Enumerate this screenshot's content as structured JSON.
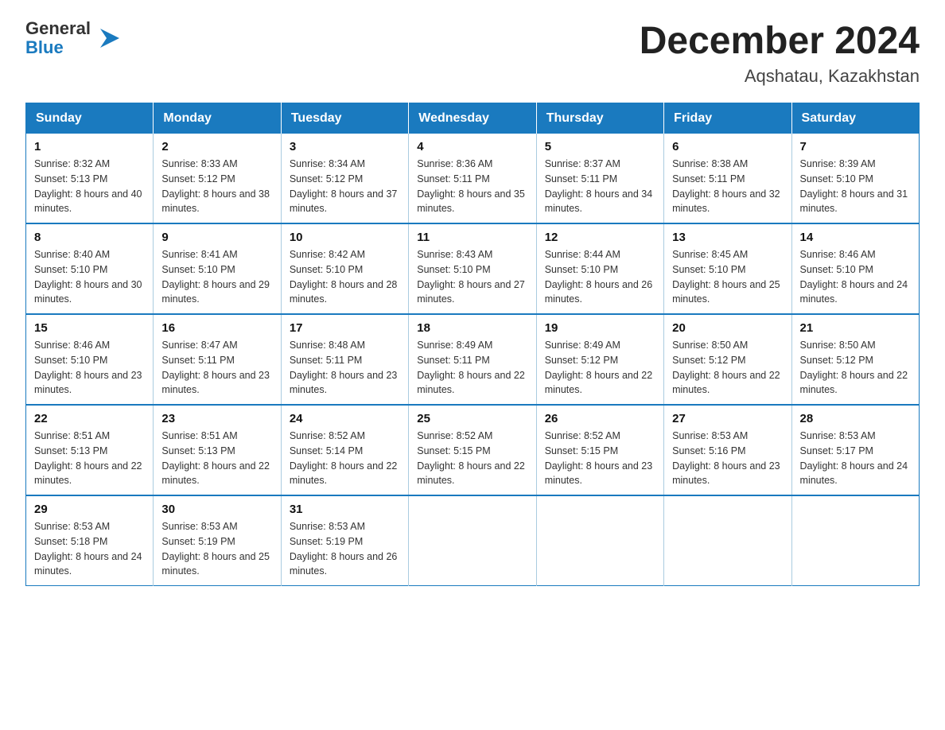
{
  "logo": {
    "text_general": "General",
    "text_blue": "Blue",
    "arrow_color": "#1a7abf"
  },
  "header": {
    "title": "December 2024",
    "subtitle": "Aqshatau, Kazakhstan"
  },
  "days_of_week": [
    "Sunday",
    "Monday",
    "Tuesday",
    "Wednesday",
    "Thursday",
    "Friday",
    "Saturday"
  ],
  "weeks": [
    [
      {
        "day": "1",
        "sunrise": "8:32 AM",
        "sunset": "5:13 PM",
        "daylight": "8 hours and 40 minutes."
      },
      {
        "day": "2",
        "sunrise": "8:33 AM",
        "sunset": "5:12 PM",
        "daylight": "8 hours and 38 minutes."
      },
      {
        "day": "3",
        "sunrise": "8:34 AM",
        "sunset": "5:12 PM",
        "daylight": "8 hours and 37 minutes."
      },
      {
        "day": "4",
        "sunrise": "8:36 AM",
        "sunset": "5:11 PM",
        "daylight": "8 hours and 35 minutes."
      },
      {
        "day": "5",
        "sunrise": "8:37 AM",
        "sunset": "5:11 PM",
        "daylight": "8 hours and 34 minutes."
      },
      {
        "day": "6",
        "sunrise": "8:38 AM",
        "sunset": "5:11 PM",
        "daylight": "8 hours and 32 minutes."
      },
      {
        "day": "7",
        "sunrise": "8:39 AM",
        "sunset": "5:10 PM",
        "daylight": "8 hours and 31 minutes."
      }
    ],
    [
      {
        "day": "8",
        "sunrise": "8:40 AM",
        "sunset": "5:10 PM",
        "daylight": "8 hours and 30 minutes."
      },
      {
        "day": "9",
        "sunrise": "8:41 AM",
        "sunset": "5:10 PM",
        "daylight": "8 hours and 29 minutes."
      },
      {
        "day": "10",
        "sunrise": "8:42 AM",
        "sunset": "5:10 PM",
        "daylight": "8 hours and 28 minutes."
      },
      {
        "day": "11",
        "sunrise": "8:43 AM",
        "sunset": "5:10 PM",
        "daylight": "8 hours and 27 minutes."
      },
      {
        "day": "12",
        "sunrise": "8:44 AM",
        "sunset": "5:10 PM",
        "daylight": "8 hours and 26 minutes."
      },
      {
        "day": "13",
        "sunrise": "8:45 AM",
        "sunset": "5:10 PM",
        "daylight": "8 hours and 25 minutes."
      },
      {
        "day": "14",
        "sunrise": "8:46 AM",
        "sunset": "5:10 PM",
        "daylight": "8 hours and 24 minutes."
      }
    ],
    [
      {
        "day": "15",
        "sunrise": "8:46 AM",
        "sunset": "5:10 PM",
        "daylight": "8 hours and 23 minutes."
      },
      {
        "day": "16",
        "sunrise": "8:47 AM",
        "sunset": "5:11 PM",
        "daylight": "8 hours and 23 minutes."
      },
      {
        "day": "17",
        "sunrise": "8:48 AM",
        "sunset": "5:11 PM",
        "daylight": "8 hours and 23 minutes."
      },
      {
        "day": "18",
        "sunrise": "8:49 AM",
        "sunset": "5:11 PM",
        "daylight": "8 hours and 22 minutes."
      },
      {
        "day": "19",
        "sunrise": "8:49 AM",
        "sunset": "5:12 PM",
        "daylight": "8 hours and 22 minutes."
      },
      {
        "day": "20",
        "sunrise": "8:50 AM",
        "sunset": "5:12 PM",
        "daylight": "8 hours and 22 minutes."
      },
      {
        "day": "21",
        "sunrise": "8:50 AM",
        "sunset": "5:12 PM",
        "daylight": "8 hours and 22 minutes."
      }
    ],
    [
      {
        "day": "22",
        "sunrise": "8:51 AM",
        "sunset": "5:13 PM",
        "daylight": "8 hours and 22 minutes."
      },
      {
        "day": "23",
        "sunrise": "8:51 AM",
        "sunset": "5:13 PM",
        "daylight": "8 hours and 22 minutes."
      },
      {
        "day": "24",
        "sunrise": "8:52 AM",
        "sunset": "5:14 PM",
        "daylight": "8 hours and 22 minutes."
      },
      {
        "day": "25",
        "sunrise": "8:52 AM",
        "sunset": "5:15 PM",
        "daylight": "8 hours and 22 minutes."
      },
      {
        "day": "26",
        "sunrise": "8:52 AM",
        "sunset": "5:15 PM",
        "daylight": "8 hours and 23 minutes."
      },
      {
        "day": "27",
        "sunrise": "8:53 AM",
        "sunset": "5:16 PM",
        "daylight": "8 hours and 23 minutes."
      },
      {
        "day": "28",
        "sunrise": "8:53 AM",
        "sunset": "5:17 PM",
        "daylight": "8 hours and 24 minutes."
      }
    ],
    [
      {
        "day": "29",
        "sunrise": "8:53 AM",
        "sunset": "5:18 PM",
        "daylight": "8 hours and 24 minutes."
      },
      {
        "day": "30",
        "sunrise": "8:53 AM",
        "sunset": "5:19 PM",
        "daylight": "8 hours and 25 minutes."
      },
      {
        "day": "31",
        "sunrise": "8:53 AM",
        "sunset": "5:19 PM",
        "daylight": "8 hours and 26 minutes."
      },
      null,
      null,
      null,
      null
    ]
  ]
}
